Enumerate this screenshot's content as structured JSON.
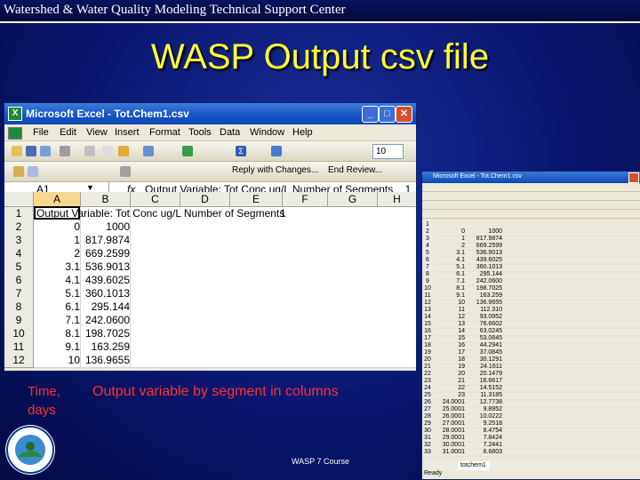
{
  "header": {
    "org": "Watershed & Water Quality Modeling Technical Support Center"
  },
  "slide": {
    "title": "WASP Output csv file",
    "time_label_1": "Time,",
    "time_label_2": "days",
    "output_label": "Output variable by segment in columns",
    "footer": "WASP 7 Course"
  },
  "excel": {
    "title": "Microsoft Excel - Tot.Chem1.csv",
    "menu": [
      "File",
      "Edit",
      "View",
      "Insert",
      "Format",
      "Tools",
      "Data",
      "Window",
      "Help"
    ],
    "font_size": "10",
    "review_text": "Reply with Changes...",
    "end_review": "End Review...",
    "name_box": "A1",
    "fx": "fx",
    "formula": "Output Variable: Tot Conc ug/L Number of Segments    1",
    "columns": [
      "A",
      "B",
      "C",
      "D",
      "E",
      "F",
      "G",
      "H"
    ],
    "row1_text": "Output Variable: Tot Conc ug/L Number of Segments",
    "row1_seg": "1",
    "rows": [
      {
        "n": "1",
        "a": "",
        "b": ""
      },
      {
        "n": "2",
        "a": "0",
        "b": "1000"
      },
      {
        "n": "3",
        "a": "1",
        "b": "817.9874"
      },
      {
        "n": "4",
        "a": "2",
        "b": "669.2599"
      },
      {
        "n": "5",
        "a": "3.1",
        "b": "536.9013"
      },
      {
        "n": "6",
        "a": "4.1",
        "b": "439.6025"
      },
      {
        "n": "7",
        "a": "5.1",
        "b": "360.1013"
      },
      {
        "n": "8",
        "a": "6.1",
        "b": "295.144"
      },
      {
        "n": "9",
        "a": "7.1",
        "b": "242.0600"
      },
      {
        "n": "10",
        "a": "8.1",
        "b": "198.7025"
      },
      {
        "n": "11",
        "a": "9.1",
        "b": "163.259"
      },
      {
        "n": "12",
        "a": "10",
        "b": "136.9655"
      }
    ]
  },
  "excel_small": {
    "title": "Microsoft Excel - Tot.Chem1.csv",
    "rows": [
      {
        "n": "1",
        "a": "",
        "b": ""
      },
      {
        "n": "2",
        "a": "0",
        "b": "1000"
      },
      {
        "n": "3",
        "a": "1",
        "b": "817.9874"
      },
      {
        "n": "4",
        "a": "2",
        "b": "669.2599"
      },
      {
        "n": "5",
        "a": "3.1",
        "b": "536.9013"
      },
      {
        "n": "6",
        "a": "4.1",
        "b": "439.6025"
      },
      {
        "n": "7",
        "a": "5.1",
        "b": "360.1013"
      },
      {
        "n": "8",
        "a": "6.1",
        "b": "295.144"
      },
      {
        "n": "9",
        "a": "7.1",
        "b": "242.0600"
      },
      {
        "n": "10",
        "a": "8.1",
        "b": "198.7025"
      },
      {
        "n": "11",
        "a": "9.1",
        "b": "163.259"
      },
      {
        "n": "12",
        "a": "10",
        "b": "136.9655"
      },
      {
        "n": "13",
        "a": "11",
        "b": "112.310"
      },
      {
        "n": "14",
        "a": "12",
        "b": "93.0952"
      },
      {
        "n": "15",
        "a": "13",
        "b": "76.6602"
      },
      {
        "n": "16",
        "a": "14",
        "b": "63.0245"
      },
      {
        "n": "17",
        "a": "15",
        "b": "53.0845"
      },
      {
        "n": "18",
        "a": "16",
        "b": "44.2941"
      },
      {
        "n": "19",
        "a": "17",
        "b": "37.0845"
      },
      {
        "n": "20",
        "a": "18",
        "b": "30.1291"
      },
      {
        "n": "21",
        "a": "19",
        "b": "24.1611"
      },
      {
        "n": "22",
        "a": "20",
        "b": "20.1479"
      },
      {
        "n": "23",
        "a": "21",
        "b": "16.6617"
      },
      {
        "n": "24",
        "a": "22",
        "b": "14.5152"
      },
      {
        "n": "25",
        "a": "23",
        "b": "11.3185"
      },
      {
        "n": "26",
        "a": "24.0001",
        "b": "12.7738"
      },
      {
        "n": "27",
        "a": "25.0001",
        "b": "9.8952"
      },
      {
        "n": "28",
        "a": "26.0001",
        "b": "10.0222"
      },
      {
        "n": "29",
        "a": "27.0001",
        "b": "9.2518"
      },
      {
        "n": "30",
        "a": "28.0001",
        "b": "8.4754"
      },
      {
        "n": "31",
        "a": "29.0001",
        "b": "7.8424"
      },
      {
        "n": "32",
        "a": "30.0001",
        "b": "7.2441"
      },
      {
        "n": "33",
        "a": "31.0001",
        "b": "6.6803"
      }
    ],
    "sheet_tab": "totchem1",
    "status": "Ready"
  }
}
